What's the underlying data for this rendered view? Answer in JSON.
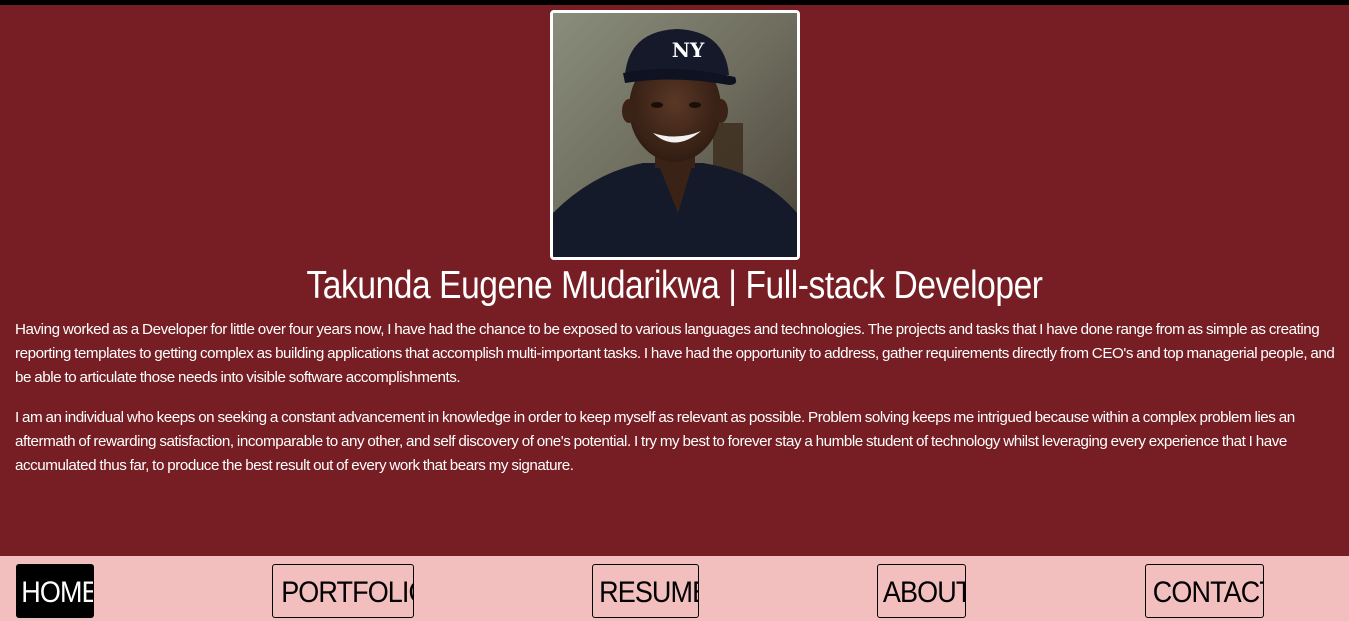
{
  "profile": {
    "photo_alt": "Takunda Eugene Mudarikwa",
    "headline": "Takunda Eugene Mudarikwa | Full-stack Developer"
  },
  "bio": {
    "paragraphs": [
      "Having worked as a Developer for little over four years now, I have had the chance to be exposed to various languages and technologies. The projects and tasks that I have done range from as simple as creating reporting templates to getting complex as building applications that accomplish multi-important tasks. I have had the opportunity to address, gather requirements directly from CEO's and top managerial people, and be able to articulate those needs into visible software accomplishments.",
      "I am an individual who keeps on seeking a constant advancement in knowledge in order to keep myself as relevant as possible. Problem solving keeps me intrigued because within a complex problem lies an aftermath of rewarding satisfaction, incomparable to any other, and self discovery of one's potential. I try my best to forever stay a humble student of technology whilst leveraging every experience that I have accumulated thus far, to produce the best result out of every work that bears my signature."
    ]
  },
  "nav": {
    "items": [
      {
        "label": "HOME",
        "active": true
      },
      {
        "label": "PORTFOLIO",
        "active": false
      },
      {
        "label": "RESUME",
        "active": false
      },
      {
        "label": "ABOUT",
        "active": false
      },
      {
        "label": "CONTACT",
        "active": false
      }
    ]
  },
  "colors": {
    "background": "#761e24",
    "nav_background": "#f2bebe",
    "text": "#ffffff",
    "active_nav": "#000000"
  }
}
